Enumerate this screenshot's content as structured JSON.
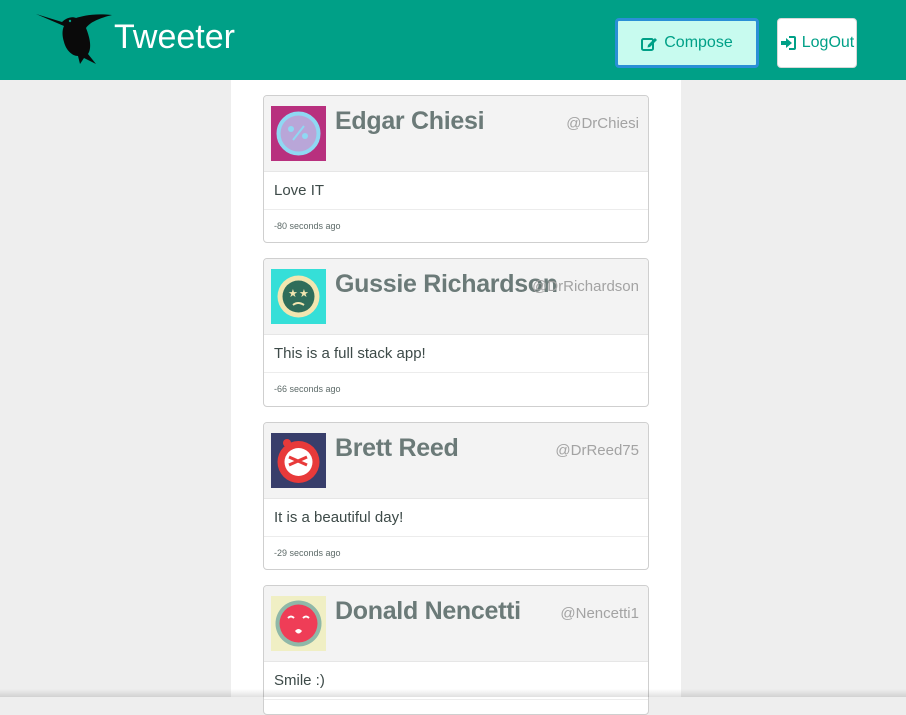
{
  "header": {
    "brand_title": "Tweeter",
    "logo_icon": "hummingbird-logo",
    "compose_label": "Compose",
    "compose_icon": "edit-icon",
    "logout_label": "LogOut",
    "logout_icon": "sign-out-icon",
    "bg_color": "#00a087"
  },
  "tweets": [
    {
      "author": "Edgar Chiesi",
      "handle": "@DrChiesi",
      "text": "Love IT",
      "time": "-80 seconds ago",
      "avatar_icon": "robot-face-avatar",
      "avatar_bg": "#b8307e"
    },
    {
      "author": "Gussie Richardson",
      "handle": "@DrRichardson",
      "text": "This is a full stack app!",
      "time": "-66 seconds ago",
      "avatar_icon": "dizzy-face-avatar",
      "avatar_bg": "#35dfd8"
    },
    {
      "author": "Brett Reed",
      "handle": "@DrReed75",
      "text": "It is a beautiful day!",
      "time": "-29 seconds ago",
      "avatar_icon": "bandaged-face-avatar",
      "avatar_bg": "#383e6b"
    },
    {
      "author": "Donald Nencetti",
      "handle": "@Nencetti1",
      "text": "Smile :)",
      "time": "",
      "avatar_icon": "kissing-face-avatar",
      "avatar_bg": "#f0efc4"
    }
  ]
}
